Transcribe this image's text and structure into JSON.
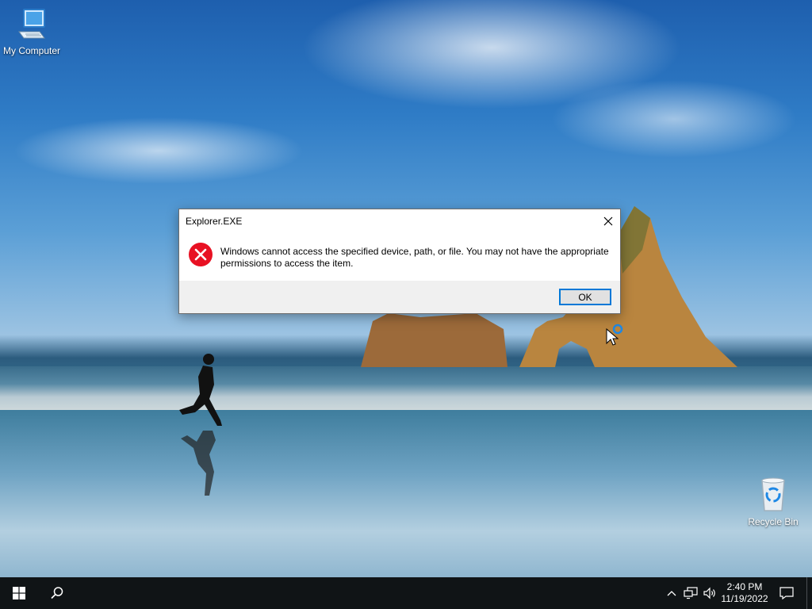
{
  "desktop": {
    "icons": [
      {
        "label": "My Computer",
        "icon": "computer-icon"
      },
      {
        "label": "Recycle Bin",
        "icon": "recycle-bin-icon"
      }
    ]
  },
  "dialog": {
    "title": "Explorer.EXE",
    "message": "Windows cannot access the specified device, path, or file. You may not have the appropriate permissions to access the item.",
    "ok_label": "OK",
    "icon": "error-icon",
    "accent": "#0078d7",
    "error_color": "#e81123"
  },
  "taskbar": {
    "start_icon": "windows-logo-icon",
    "search_icon": "search-icon",
    "tray": {
      "icons": [
        "chevron-up-icon",
        "network-icon",
        "volume-icon"
      ],
      "time": "2:40 PM",
      "date": "11/19/2022",
      "notifications_icon": "notification-icon"
    }
  }
}
